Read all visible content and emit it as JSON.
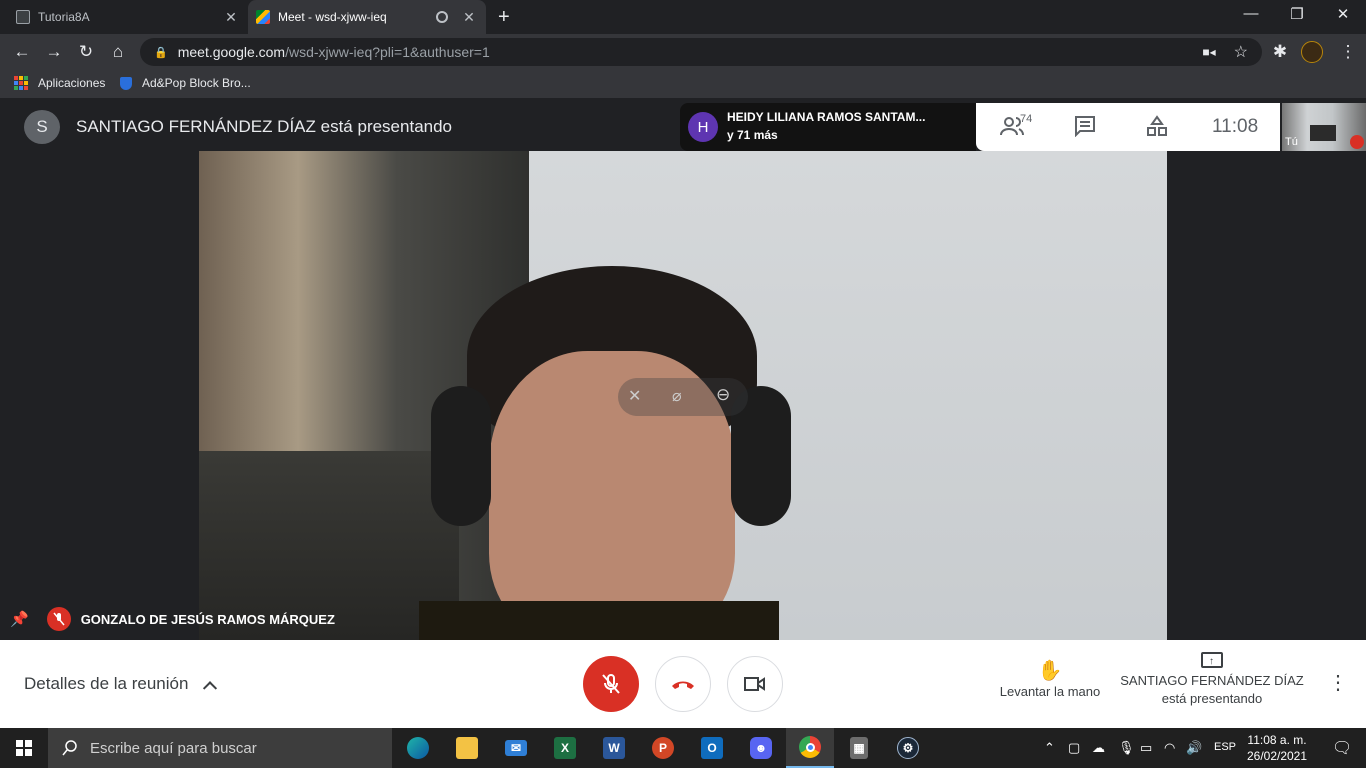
{
  "browser": {
    "tabs": [
      {
        "title": "Tutoria8A",
        "close": "✕"
      },
      {
        "title": "Meet - wsd-xjww-ieq",
        "close": "✕",
        "active": true
      }
    ],
    "new_tab": "+",
    "window_controls": {
      "minimize": "—",
      "maximize": "❐",
      "close": "✕"
    },
    "url_host": "meet.google.com",
    "url_path": "/wsd-xjww-ieq?pli=1&authuser=1",
    "bookmarks": [
      {
        "label": "Aplicaciones"
      },
      {
        "label": "Ad&Pop Block Bro..."
      }
    ]
  },
  "meet": {
    "presenter_initial": "S",
    "presenter_status": "SANTIAGO FERNÁNDEZ DÍAZ está presentando",
    "participants_preview": {
      "initial": "H",
      "name": "HEIDY LILIANA RAMOS SANTAM...",
      "more": "y 71 más"
    },
    "participant_count": "74",
    "time": "11:08",
    "self_label": "Tú",
    "tile_name": "GONZALO DE JESÚS RAMOS MÁRQUEZ",
    "meeting_details": "Detalles de la reunión",
    "raise_hand": "Levantar la mano",
    "presenting_name": "SANTIAGO FERNÁNDEZ DÍAZ",
    "presenting_status": "está presentando",
    "accent_red": "#d93025"
  },
  "taskbar": {
    "search_placeholder": "Escribe aquí para buscar",
    "language": "ESP",
    "time": "11:08 a. m.",
    "date": "26/02/2021",
    "apps": [
      "edge-icon",
      "file-explorer-icon",
      "mail-icon",
      "excel-icon",
      "word-icon",
      "powerpoint-icon",
      "outlook-icon",
      "discord-icon",
      "chrome-icon",
      "calculator-icon",
      "steam-icon"
    ]
  }
}
